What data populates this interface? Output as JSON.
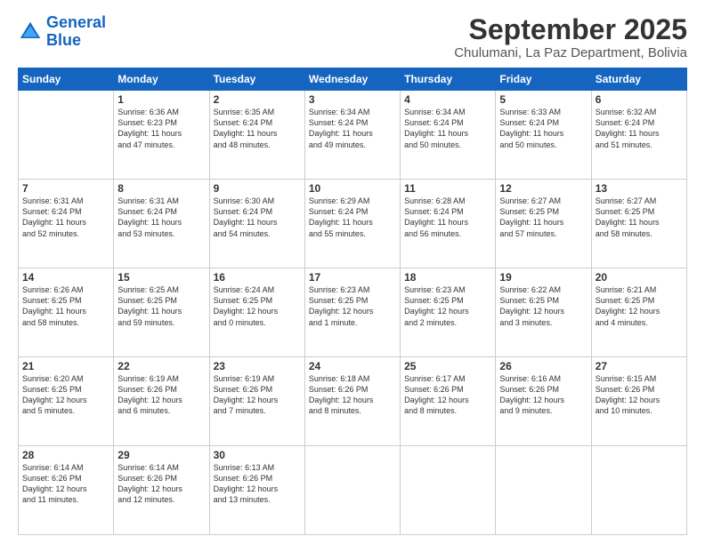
{
  "logo": {
    "line1": "General",
    "line2": "Blue"
  },
  "title": "September 2025",
  "subtitle": "Chulumani, La Paz Department, Bolivia",
  "weekdays": [
    "Sunday",
    "Monday",
    "Tuesday",
    "Wednesday",
    "Thursday",
    "Friday",
    "Saturday"
  ],
  "weeks": [
    [
      {
        "day": "",
        "info": ""
      },
      {
        "day": "1",
        "info": "Sunrise: 6:36 AM\nSunset: 6:23 PM\nDaylight: 11 hours\nand 47 minutes."
      },
      {
        "day": "2",
        "info": "Sunrise: 6:35 AM\nSunset: 6:24 PM\nDaylight: 11 hours\nand 48 minutes."
      },
      {
        "day": "3",
        "info": "Sunrise: 6:34 AM\nSunset: 6:24 PM\nDaylight: 11 hours\nand 49 minutes."
      },
      {
        "day": "4",
        "info": "Sunrise: 6:34 AM\nSunset: 6:24 PM\nDaylight: 11 hours\nand 50 minutes."
      },
      {
        "day": "5",
        "info": "Sunrise: 6:33 AM\nSunset: 6:24 PM\nDaylight: 11 hours\nand 50 minutes."
      },
      {
        "day": "6",
        "info": "Sunrise: 6:32 AM\nSunset: 6:24 PM\nDaylight: 11 hours\nand 51 minutes."
      }
    ],
    [
      {
        "day": "7",
        "info": "Sunrise: 6:31 AM\nSunset: 6:24 PM\nDaylight: 11 hours\nand 52 minutes."
      },
      {
        "day": "8",
        "info": "Sunrise: 6:31 AM\nSunset: 6:24 PM\nDaylight: 11 hours\nand 53 minutes."
      },
      {
        "day": "9",
        "info": "Sunrise: 6:30 AM\nSunset: 6:24 PM\nDaylight: 11 hours\nand 54 minutes."
      },
      {
        "day": "10",
        "info": "Sunrise: 6:29 AM\nSunset: 6:24 PM\nDaylight: 11 hours\nand 55 minutes."
      },
      {
        "day": "11",
        "info": "Sunrise: 6:28 AM\nSunset: 6:24 PM\nDaylight: 11 hours\nand 56 minutes."
      },
      {
        "day": "12",
        "info": "Sunrise: 6:27 AM\nSunset: 6:25 PM\nDaylight: 11 hours\nand 57 minutes."
      },
      {
        "day": "13",
        "info": "Sunrise: 6:27 AM\nSunset: 6:25 PM\nDaylight: 11 hours\nand 58 minutes."
      }
    ],
    [
      {
        "day": "14",
        "info": "Sunrise: 6:26 AM\nSunset: 6:25 PM\nDaylight: 11 hours\nand 58 minutes."
      },
      {
        "day": "15",
        "info": "Sunrise: 6:25 AM\nSunset: 6:25 PM\nDaylight: 11 hours\nand 59 minutes."
      },
      {
        "day": "16",
        "info": "Sunrise: 6:24 AM\nSunset: 6:25 PM\nDaylight: 12 hours\nand 0 minutes."
      },
      {
        "day": "17",
        "info": "Sunrise: 6:23 AM\nSunset: 6:25 PM\nDaylight: 12 hours\nand 1 minute."
      },
      {
        "day": "18",
        "info": "Sunrise: 6:23 AM\nSunset: 6:25 PM\nDaylight: 12 hours\nand 2 minutes."
      },
      {
        "day": "19",
        "info": "Sunrise: 6:22 AM\nSunset: 6:25 PM\nDaylight: 12 hours\nand 3 minutes."
      },
      {
        "day": "20",
        "info": "Sunrise: 6:21 AM\nSunset: 6:25 PM\nDaylight: 12 hours\nand 4 minutes."
      }
    ],
    [
      {
        "day": "21",
        "info": "Sunrise: 6:20 AM\nSunset: 6:25 PM\nDaylight: 12 hours\nand 5 minutes."
      },
      {
        "day": "22",
        "info": "Sunrise: 6:19 AM\nSunset: 6:26 PM\nDaylight: 12 hours\nand 6 minutes."
      },
      {
        "day": "23",
        "info": "Sunrise: 6:19 AM\nSunset: 6:26 PM\nDaylight: 12 hours\nand 7 minutes."
      },
      {
        "day": "24",
        "info": "Sunrise: 6:18 AM\nSunset: 6:26 PM\nDaylight: 12 hours\nand 8 minutes."
      },
      {
        "day": "25",
        "info": "Sunrise: 6:17 AM\nSunset: 6:26 PM\nDaylight: 12 hours\nand 8 minutes."
      },
      {
        "day": "26",
        "info": "Sunrise: 6:16 AM\nSunset: 6:26 PM\nDaylight: 12 hours\nand 9 minutes."
      },
      {
        "day": "27",
        "info": "Sunrise: 6:15 AM\nSunset: 6:26 PM\nDaylight: 12 hours\nand 10 minutes."
      }
    ],
    [
      {
        "day": "28",
        "info": "Sunrise: 6:14 AM\nSunset: 6:26 PM\nDaylight: 12 hours\nand 11 minutes."
      },
      {
        "day": "29",
        "info": "Sunrise: 6:14 AM\nSunset: 6:26 PM\nDaylight: 12 hours\nand 12 minutes."
      },
      {
        "day": "30",
        "info": "Sunrise: 6:13 AM\nSunset: 6:26 PM\nDaylight: 12 hours\nand 13 minutes."
      },
      {
        "day": "",
        "info": ""
      },
      {
        "day": "",
        "info": ""
      },
      {
        "day": "",
        "info": ""
      },
      {
        "day": "",
        "info": ""
      }
    ]
  ]
}
